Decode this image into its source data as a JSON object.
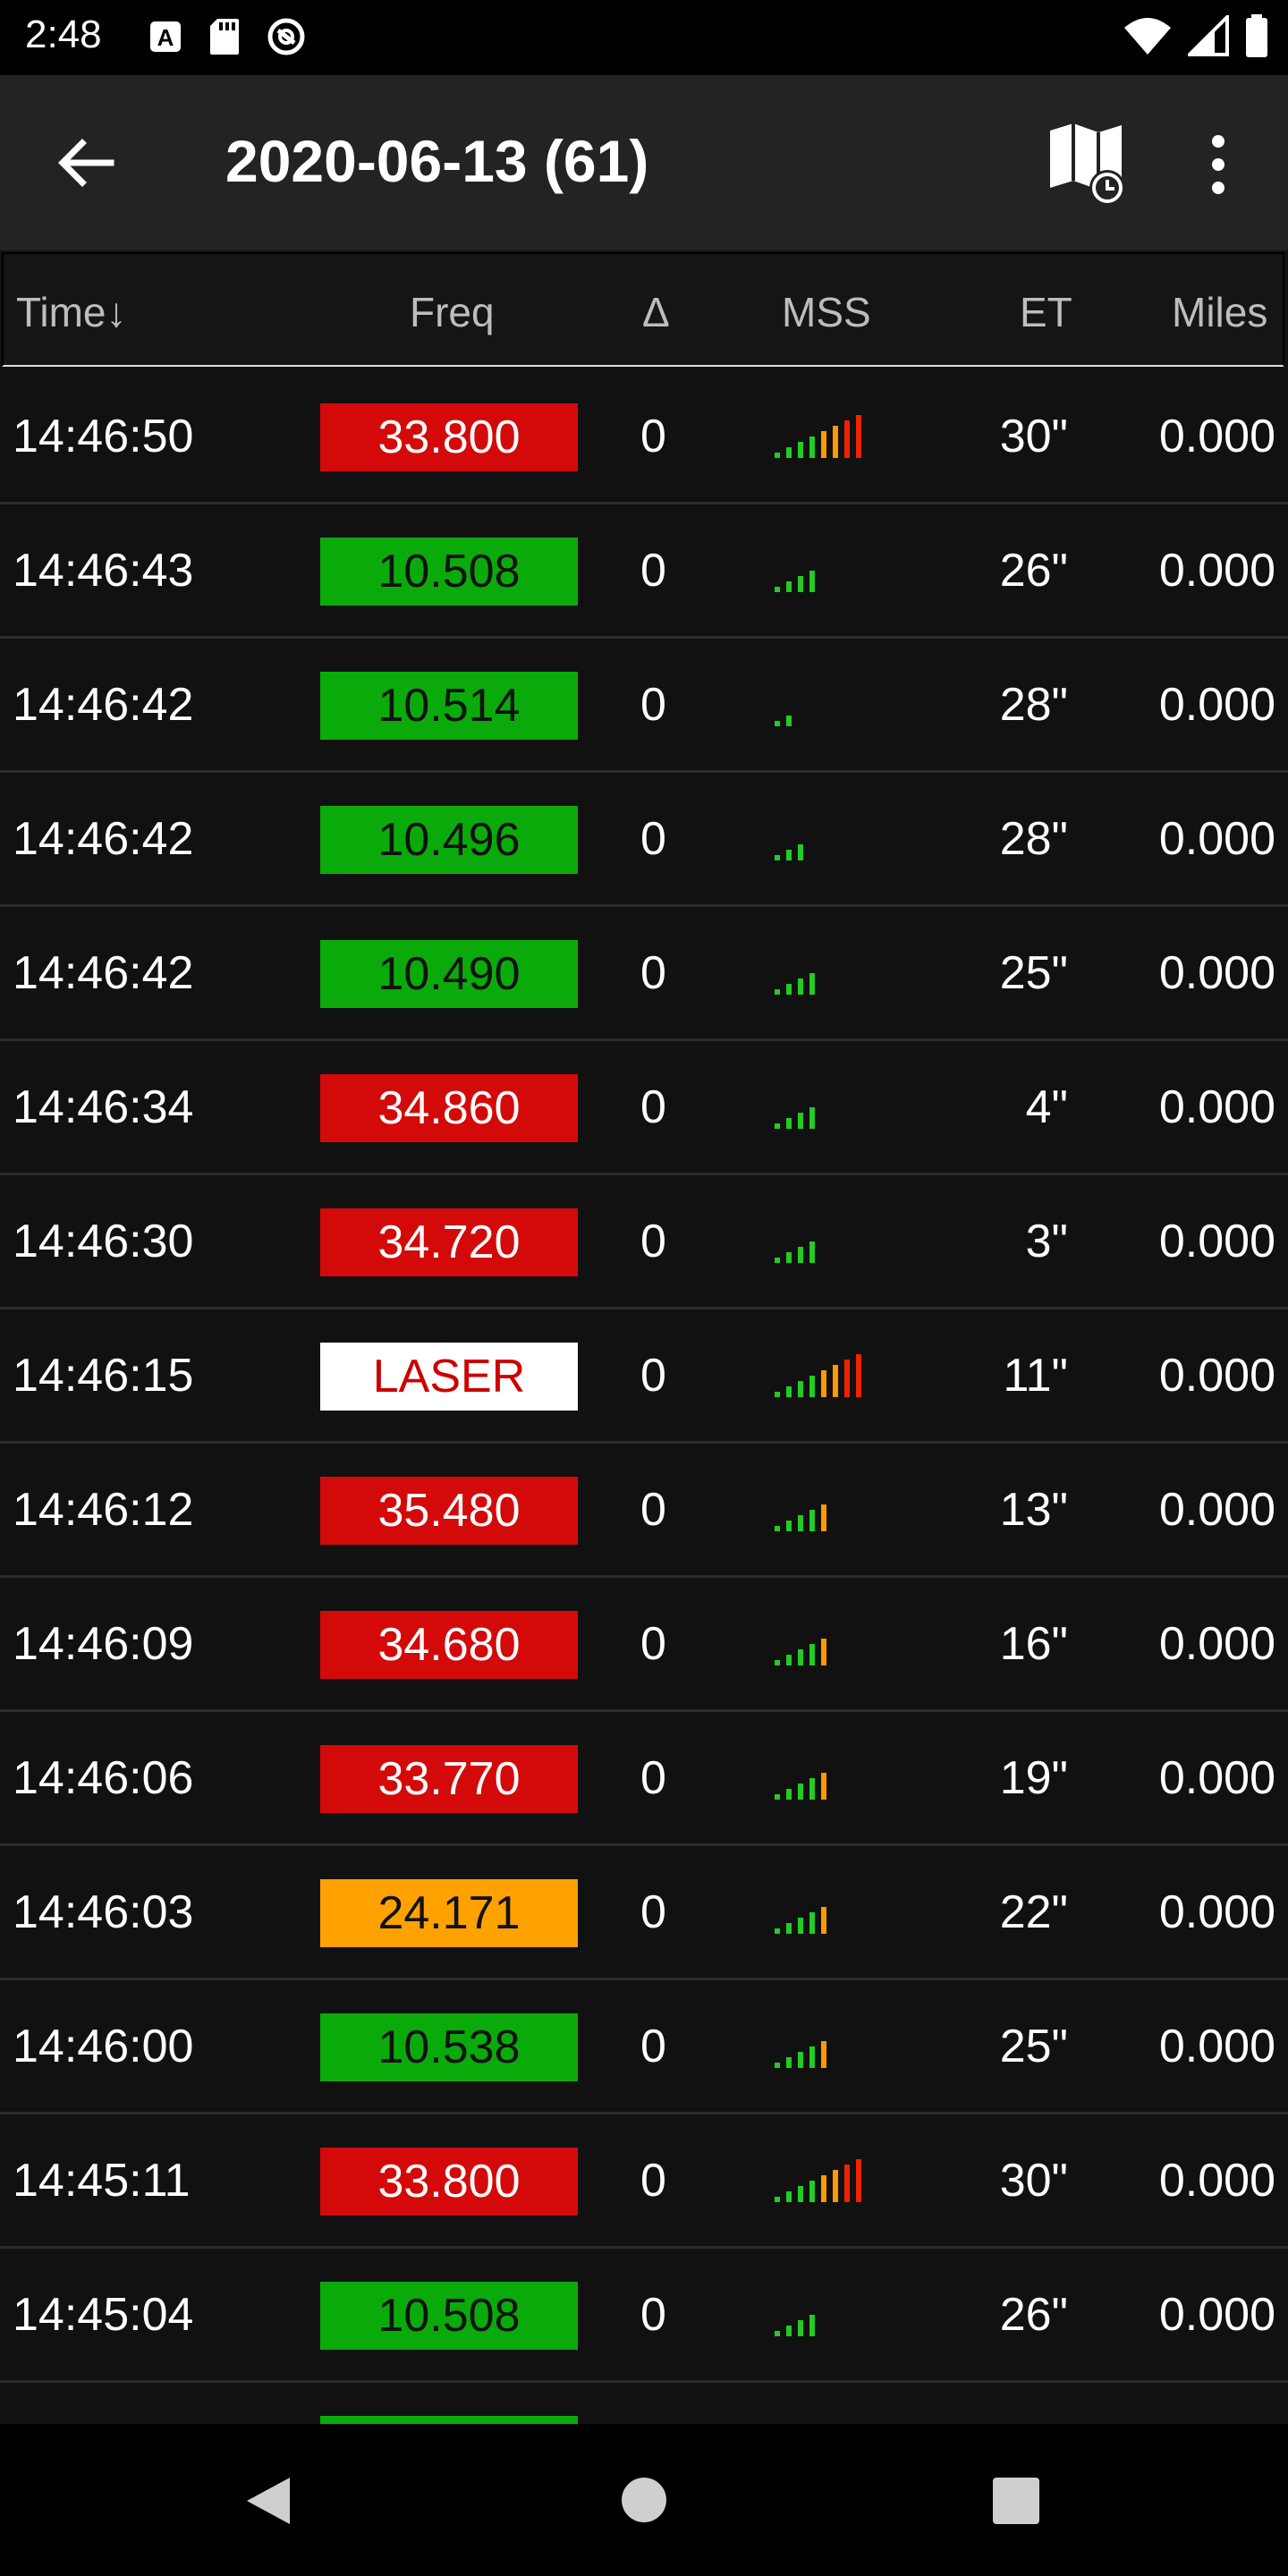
{
  "status_bar": {
    "time": "2:48",
    "left_icons": [
      "a-icon",
      "sd-card-icon",
      "do-not-disturb-icon"
    ],
    "right_icons": [
      "wifi-icon",
      "signal-icon",
      "battery-icon"
    ]
  },
  "app_bar": {
    "title": "2020-06-13 (61)",
    "icons": [
      "back-arrow-icon",
      "map-history-icon",
      "more-vert-icon"
    ]
  },
  "table": {
    "headers": {
      "time": "Time↓",
      "freq": "Freq",
      "delta": "Δ",
      "mss": "MSS",
      "et": "ET",
      "miles": "Miles"
    },
    "rows": [
      {
        "time": "14:46:50",
        "freq": "33.800",
        "freq_bg": "#d40a0a",
        "freq_fg": "#ffffff",
        "delta": "0",
        "mss_level": 8,
        "et": "30\"",
        "miles": "0.000"
      },
      {
        "time": "14:46:43",
        "freq": "10.508",
        "freq_bg": "#0aaa0a",
        "freq_fg": "#111111",
        "delta": "0",
        "mss_level": 4,
        "et": "26\"",
        "miles": "0.000"
      },
      {
        "time": "14:46:42",
        "freq": "10.514",
        "freq_bg": "#0aaa0a",
        "freq_fg": "#111111",
        "delta": "0",
        "mss_level": 2,
        "et": "28\"",
        "miles": "0.000"
      },
      {
        "time": "14:46:42",
        "freq": "10.496",
        "freq_bg": "#0aaa0a",
        "freq_fg": "#111111",
        "delta": "0",
        "mss_level": 3,
        "et": "28\"",
        "miles": "0.000"
      },
      {
        "time": "14:46:42",
        "freq": "10.490",
        "freq_bg": "#0aaa0a",
        "freq_fg": "#111111",
        "delta": "0",
        "mss_level": 4,
        "et": "25\"",
        "miles": "0.000"
      },
      {
        "time": "14:46:34",
        "freq": "34.860",
        "freq_bg": "#d40a0a",
        "freq_fg": "#ffffff",
        "delta": "0",
        "mss_level": 4,
        "et": "4\"",
        "miles": "0.000"
      },
      {
        "time": "14:46:30",
        "freq": "34.720",
        "freq_bg": "#d40a0a",
        "freq_fg": "#ffffff",
        "delta": "0",
        "mss_level": 4,
        "et": "3\"",
        "miles": "0.000"
      },
      {
        "time": "14:46:15",
        "freq": "LASER",
        "freq_bg": "#ffffff",
        "freq_fg": "#cc0000",
        "delta": "0",
        "mss_level": 8,
        "et": "11\"",
        "miles": "0.000"
      },
      {
        "time": "14:46:12",
        "freq": "35.480",
        "freq_bg": "#d40a0a",
        "freq_fg": "#ffffff",
        "delta": "0",
        "mss_level": 5,
        "et": "13\"",
        "miles": "0.000"
      },
      {
        "time": "14:46:09",
        "freq": "34.680",
        "freq_bg": "#d40a0a",
        "freq_fg": "#ffffff",
        "delta": "0",
        "mss_level": 5,
        "et": "16\"",
        "miles": "0.000"
      },
      {
        "time": "14:46:06",
        "freq": "33.770",
        "freq_bg": "#d40a0a",
        "freq_fg": "#ffffff",
        "delta": "0",
        "mss_level": 5,
        "et": "19\"",
        "miles": "0.000"
      },
      {
        "time": "14:46:03",
        "freq": "24.171",
        "freq_bg": "#ffa200",
        "freq_fg": "#111111",
        "delta": "0",
        "mss_level": 5,
        "et": "22\"",
        "miles": "0.000"
      },
      {
        "time": "14:46:00",
        "freq": "10.538",
        "freq_bg": "#0aaa0a",
        "freq_fg": "#111111",
        "delta": "0",
        "mss_level": 5,
        "et": "25\"",
        "miles": "0.000"
      },
      {
        "time": "14:45:11",
        "freq": "33.800",
        "freq_bg": "#d40a0a",
        "freq_fg": "#ffffff",
        "delta": "0",
        "mss_level": 8,
        "et": "30\"",
        "miles": "0.000"
      },
      {
        "time": "14:45:04",
        "freq": "10.508",
        "freq_bg": "#0aaa0a",
        "freq_fg": "#111111",
        "delta": "0",
        "mss_level": 4,
        "et": "26\"",
        "miles": "0.000"
      },
      {
        "time": "",
        "freq": "",
        "freq_bg": "#0aaa0a",
        "freq_fg": "#111111",
        "delta": "",
        "mss_level": 0,
        "et": "",
        "miles": ""
      }
    ]
  },
  "nav_bar": {
    "icons": [
      "nav-back-icon",
      "nav-home-icon",
      "nav-recents-icon"
    ]
  }
}
